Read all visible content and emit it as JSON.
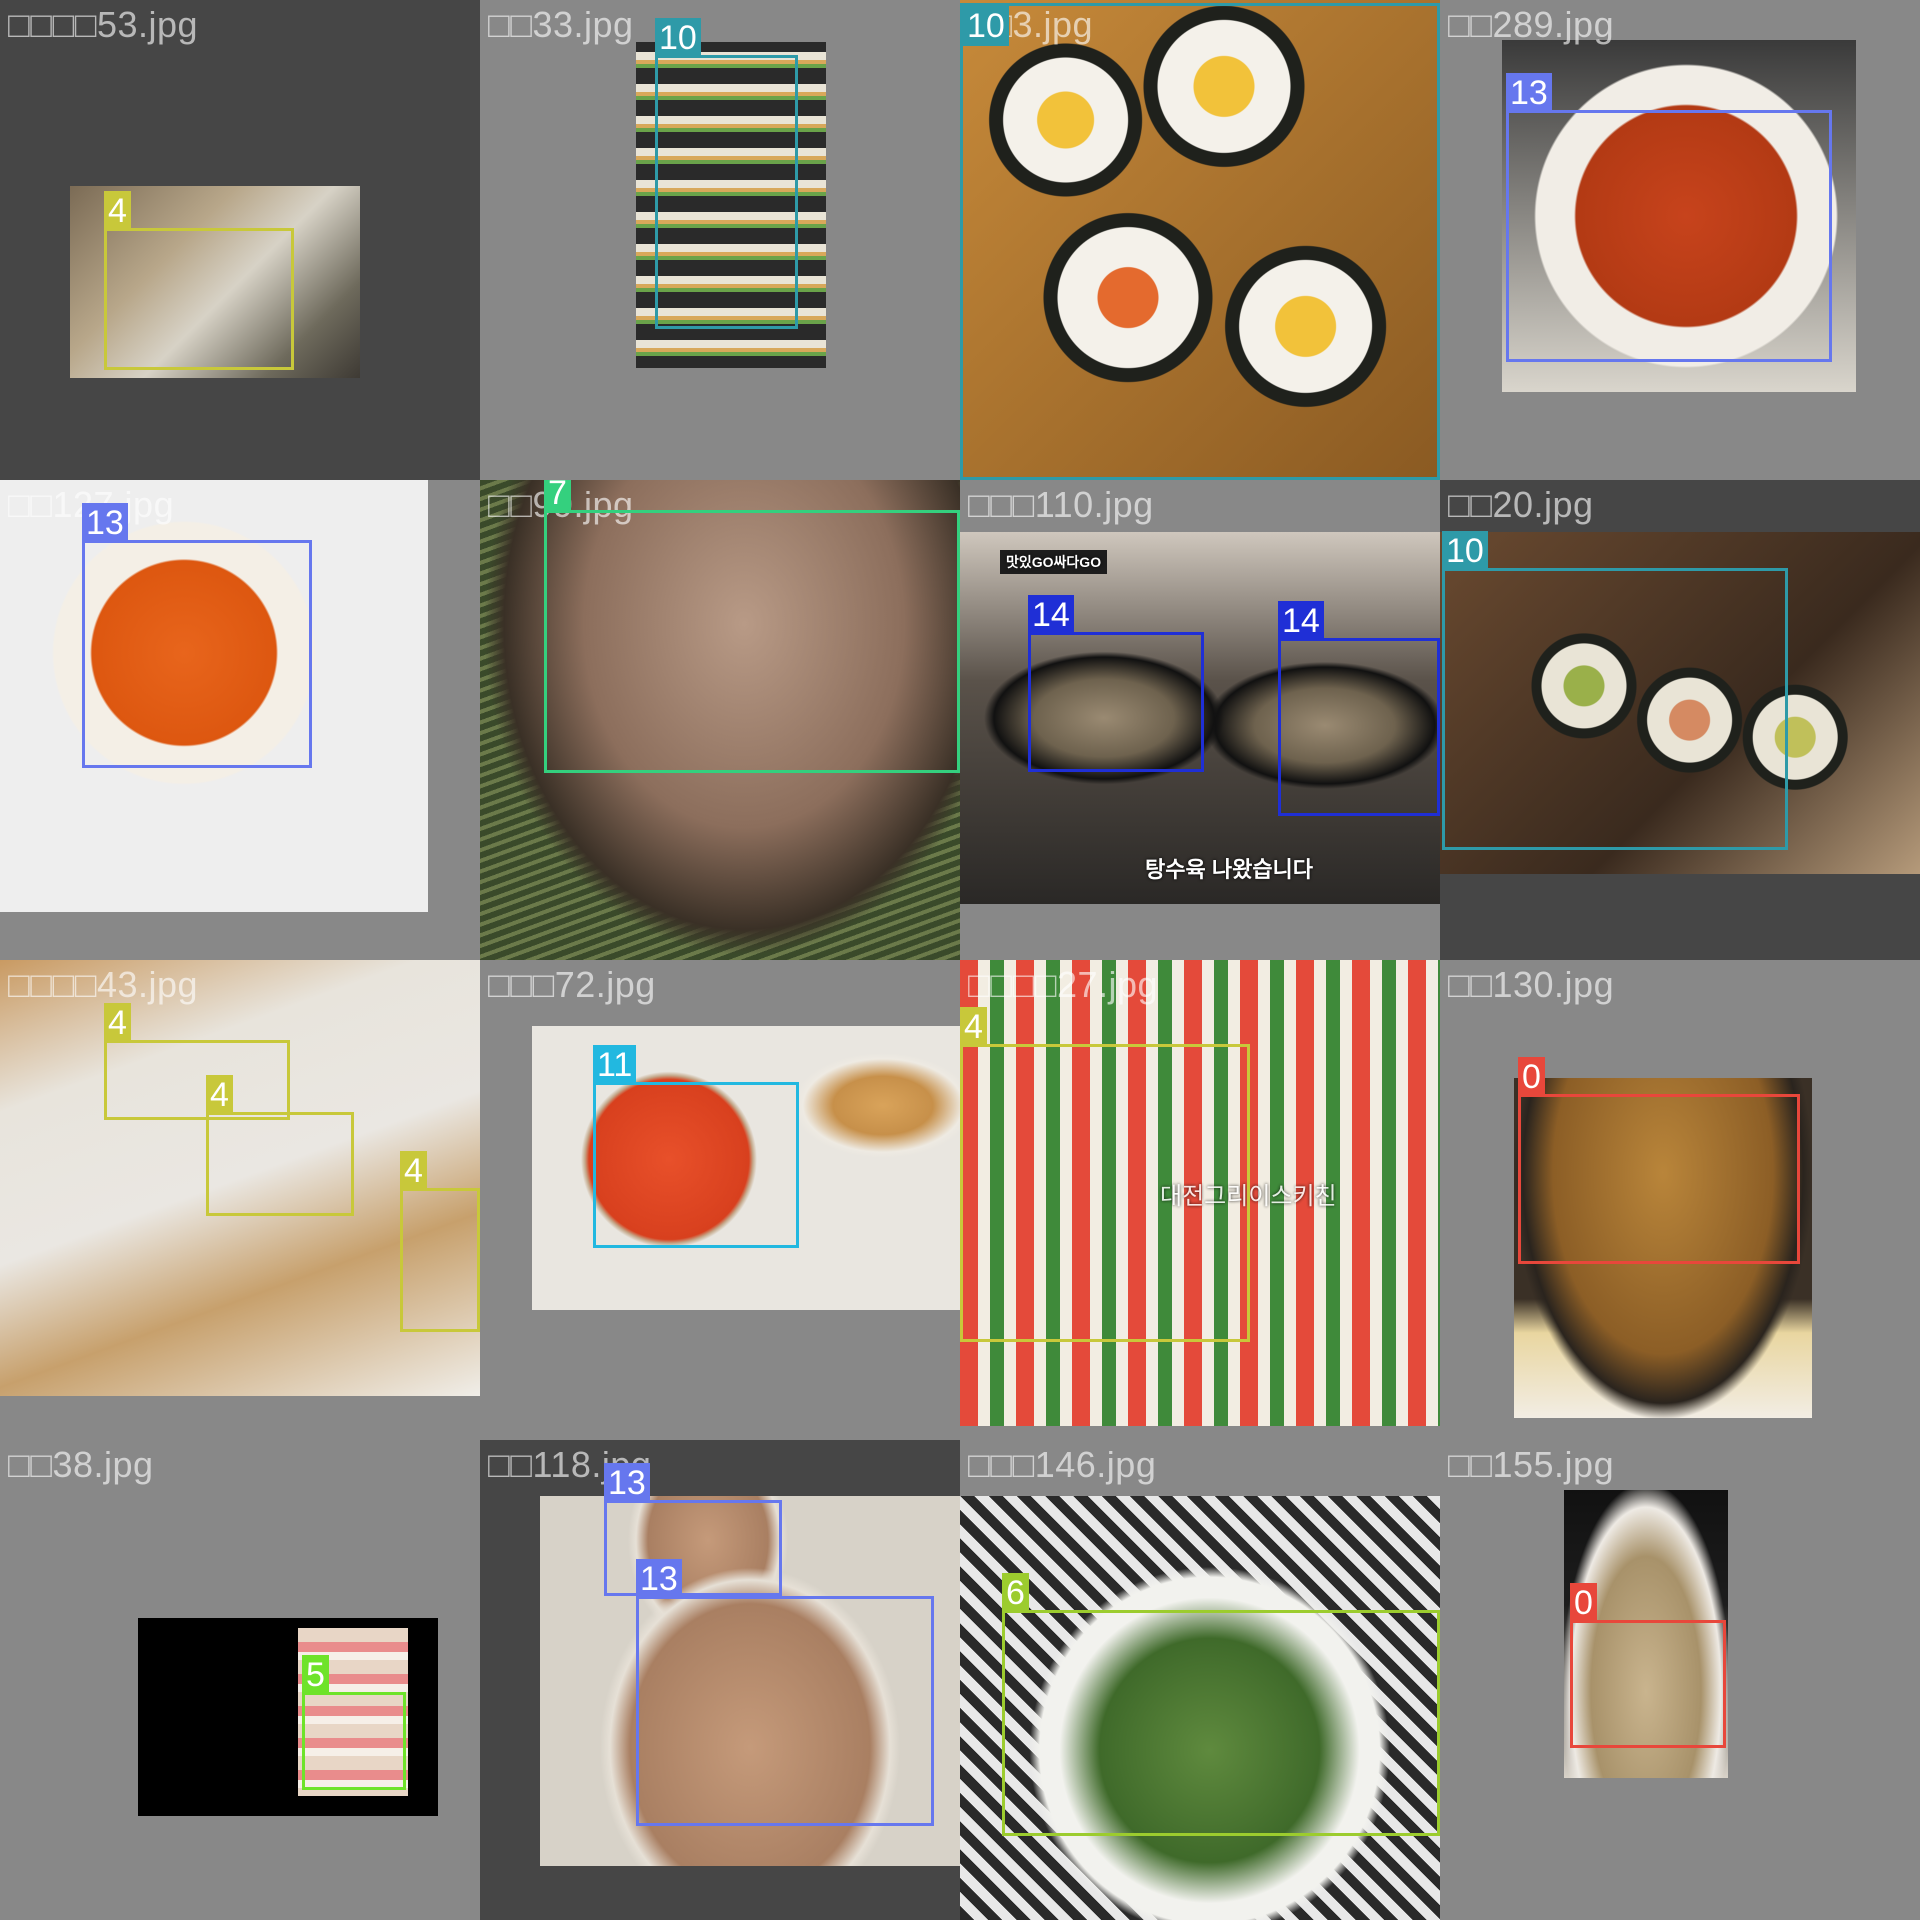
{
  "class_colors": {
    "0": "#e8473b",
    "4": "#c8c83a",
    "5": "#6ee32a",
    "6": "#9ccc2e",
    "7": "#34d07e",
    "10": "#2e9aa8",
    "11": "#22b8e0",
    "13": "#6677ee",
    "14": "#1f2fd6"
  },
  "tiles": [
    {
      "filename": "□□□□53.jpg",
      "dish": "sandwich",
      "objects": [
        {
          "label": "4"
        }
      ]
    },
    {
      "filename": "□□33.jpg",
      "dish": "gimbap platter",
      "objects": [
        {
          "label": "10"
        }
      ]
    },
    {
      "filename": "□□3.jpg",
      "dish": "gimbap closeup",
      "objects": [
        {
          "label": "10"
        }
      ]
    },
    {
      "filename": "□□289.jpg",
      "dish": "jjamppong",
      "objects": [
        {
          "label": "13"
        }
      ]
    },
    {
      "filename": "□□127.jpg",
      "dish": "jjamppong",
      "objects": [
        {
          "label": "13"
        }
      ]
    },
    {
      "filename": "□□99.jpg",
      "dish": "jokbal",
      "objects": [
        {
          "label": "7"
        }
      ]
    },
    {
      "filename": "□□□110.jpg",
      "dish": "tangsuyuk",
      "caption_top": "맛있GO싸다GO",
      "caption_bottom": "탕수육 나왔습니다",
      "objects": [
        {
          "label": "14"
        },
        {
          "label": "14"
        }
      ]
    },
    {
      "filename": "□□20.jpg",
      "dish": "gimbap",
      "objects": [
        {
          "label": "10"
        }
      ]
    },
    {
      "filename": "□□□□43.jpg",
      "dish": "sandwich boxes",
      "objects": [
        {
          "label": "4"
        },
        {
          "label": "4"
        },
        {
          "label": "4"
        }
      ]
    },
    {
      "filename": "□□□72.jpg",
      "dish": "tteokbokki",
      "objects": [
        {
          "label": "11"
        }
      ]
    },
    {
      "filename": "□□□□27.jpg",
      "dish": "sandwich",
      "caption_mid": "대전그리이스키친",
      "objects": [
        {
          "label": "4"
        }
      ]
    },
    {
      "filename": "□□130.jpg",
      "dish": "fried chicken",
      "objects": [
        {
          "label": "0"
        }
      ]
    },
    {
      "filename": "□□38.jpg",
      "dish": "sushi",
      "objects": [
        {
          "label": "5"
        }
      ]
    },
    {
      "filename": "□□118.jpg",
      "dish": "jjamppong",
      "objects": [
        {
          "label": "13"
        },
        {
          "label": "13"
        }
      ]
    },
    {
      "filename": "□□□146.jpg",
      "dish": "salad",
      "objects": [
        {
          "label": "6"
        }
      ]
    },
    {
      "filename": "□□155.jpg",
      "dish": "chicken",
      "objects": [
        {
          "label": "0"
        }
      ]
    }
  ]
}
